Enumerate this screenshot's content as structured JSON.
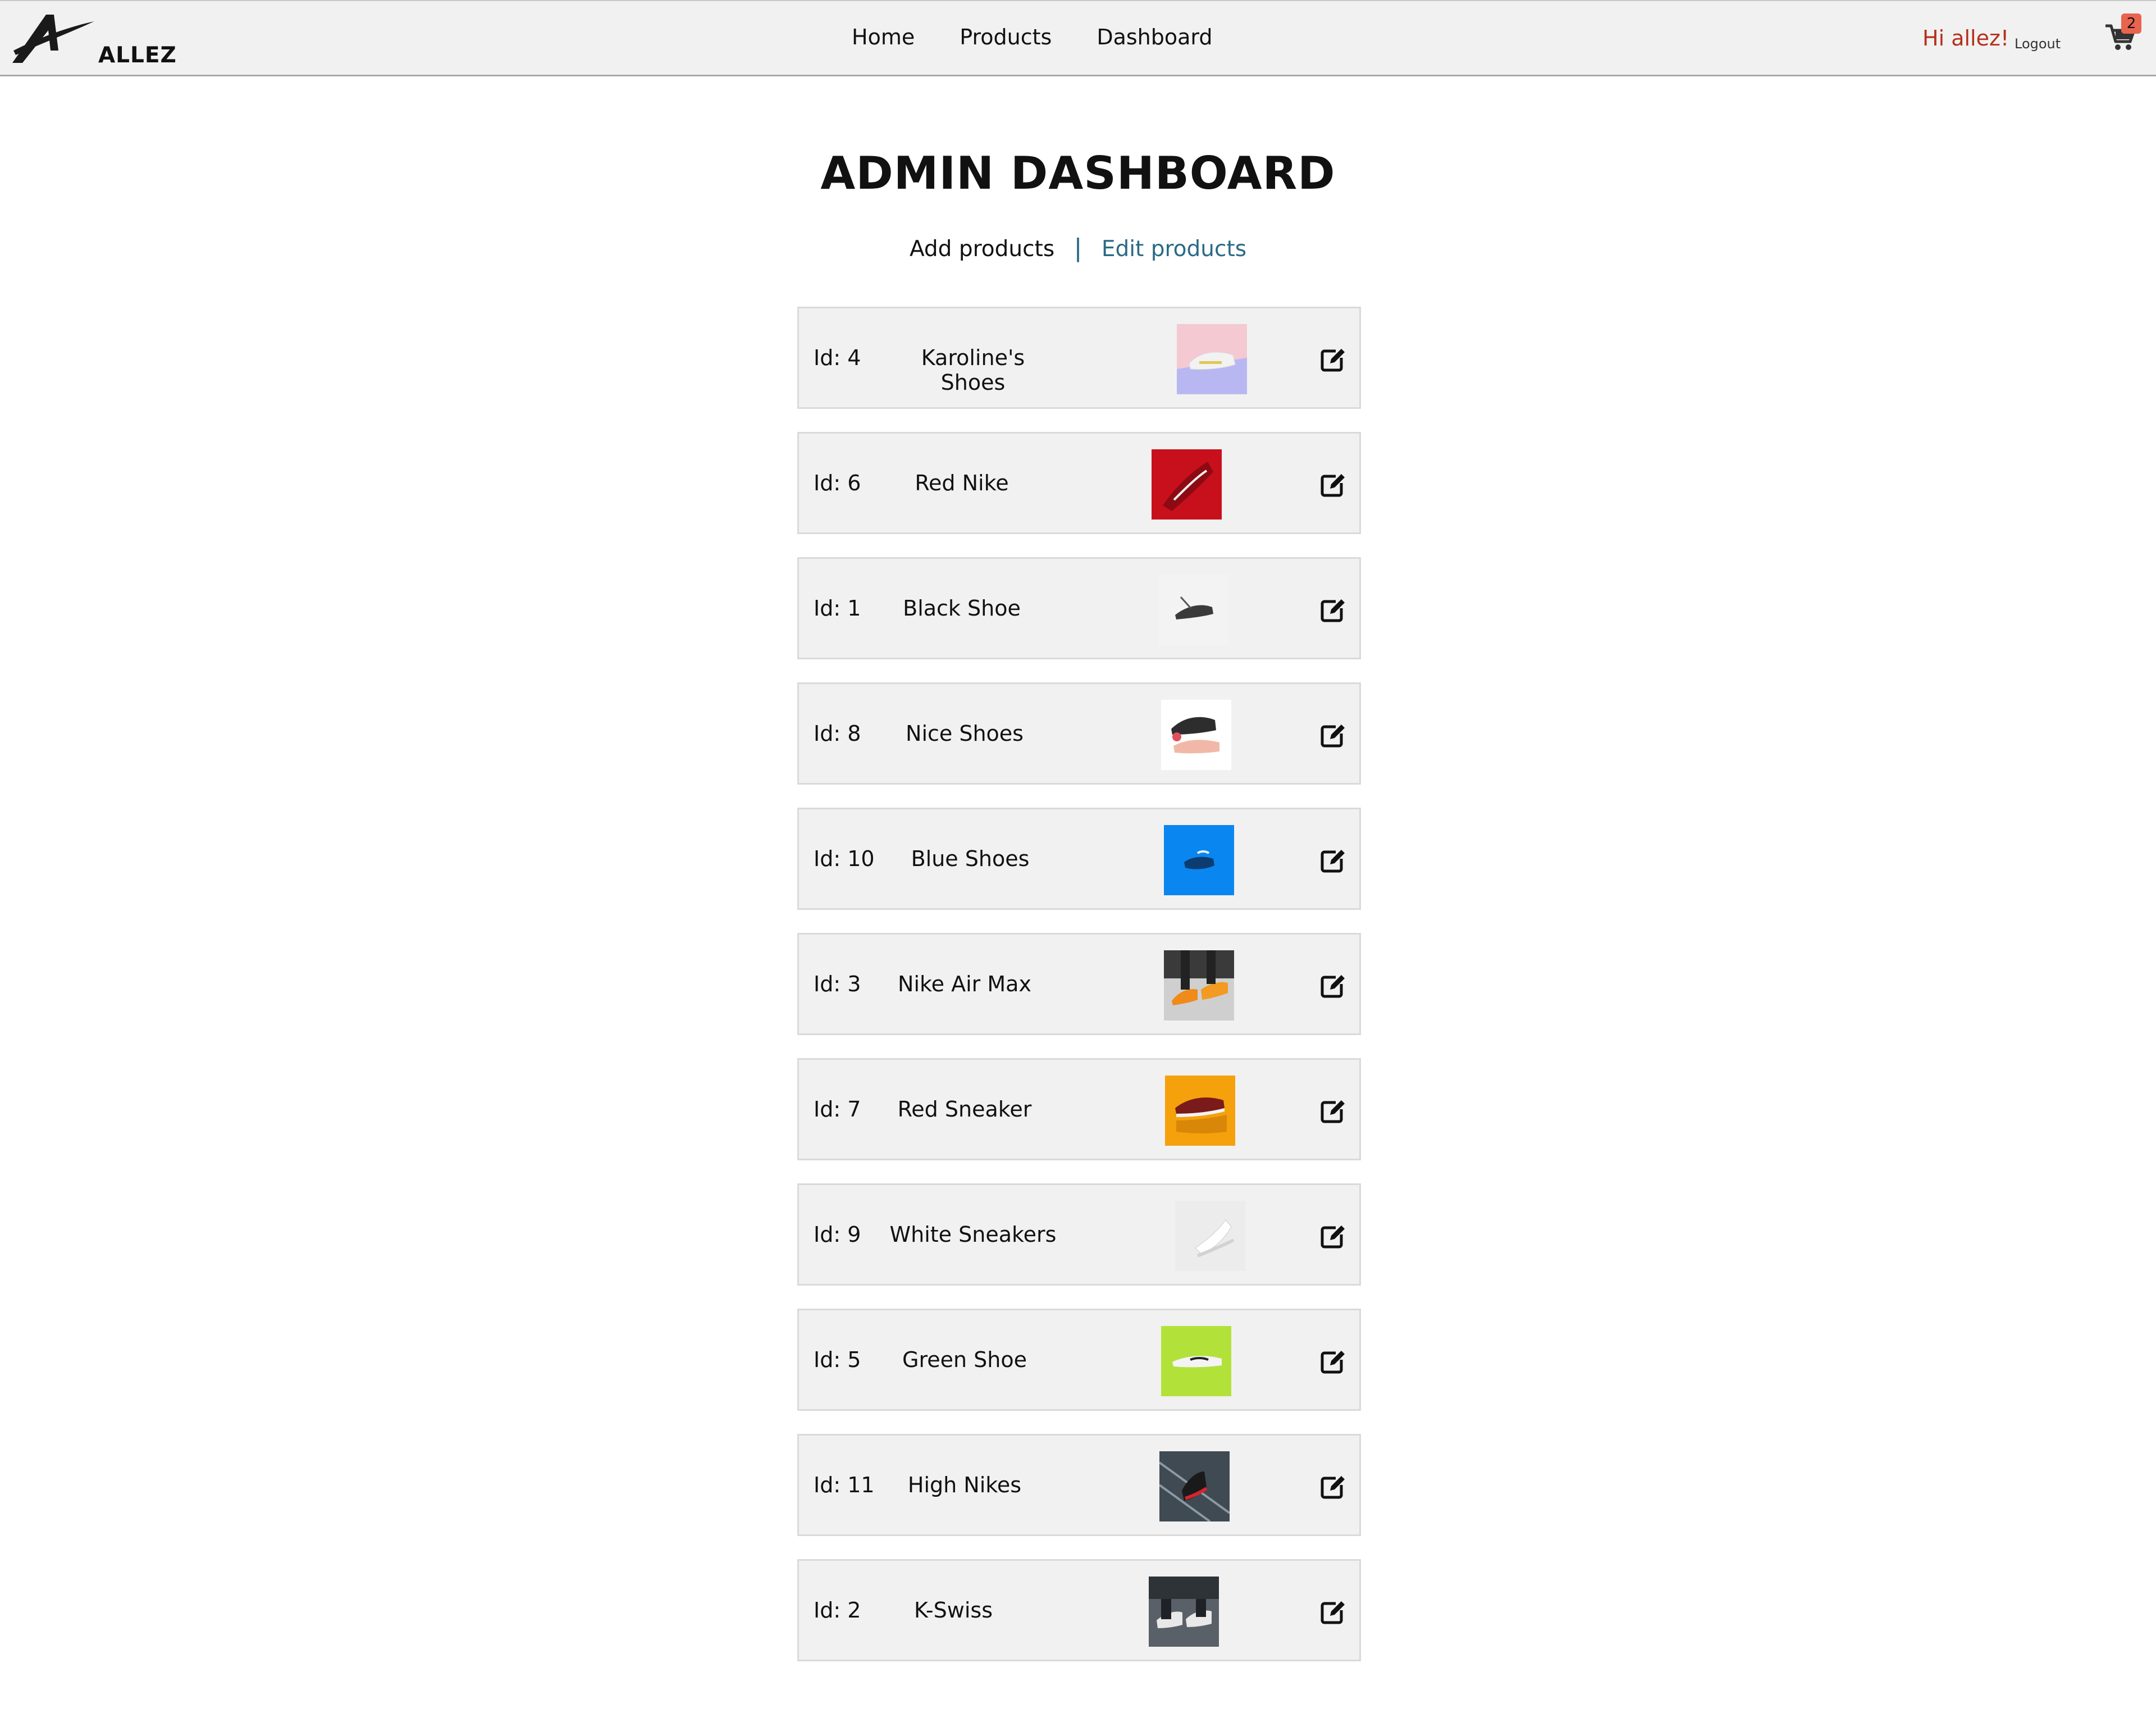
{
  "brand": {
    "name": "ALLEZ"
  },
  "nav": {
    "home": "Home",
    "products": "Products",
    "dashboard": "Dashboard"
  },
  "user": {
    "greeting": "Hi allez!",
    "logout": "Logout"
  },
  "cart": {
    "count": "2",
    "icon": "cart-icon"
  },
  "page": {
    "title": "ADMIN DASHBOARD"
  },
  "subnav": {
    "add": "Add products",
    "separator": "|",
    "edit": "Edit products"
  },
  "colors": {
    "accent": "#b5301b",
    "link": "#2a6a85",
    "badge": "#e8644e",
    "row_bg": "#f1f1f1"
  },
  "products": [
    {
      "id": "Id: 4",
      "name": "Karoline's Shoes"
    },
    {
      "id": "Id: 6",
      "name": "Red Nike"
    },
    {
      "id": "Id: 1",
      "name": "Black Shoe"
    },
    {
      "id": "Id: 8",
      "name": "Nice Shoes"
    },
    {
      "id": "Id: 10",
      "name": "Blue Shoes"
    },
    {
      "id": "Id: 3",
      "name": "Nike Air Max"
    },
    {
      "id": "Id: 7",
      "name": "Red Sneaker"
    },
    {
      "id": "Id: 9",
      "name": "White Sneakers"
    },
    {
      "id": "Id: 5",
      "name": "Green Shoe"
    },
    {
      "id": "Id: 11",
      "name": "High Nikes"
    },
    {
      "id": "Id: 2",
      "name": "K-Swiss"
    }
  ]
}
